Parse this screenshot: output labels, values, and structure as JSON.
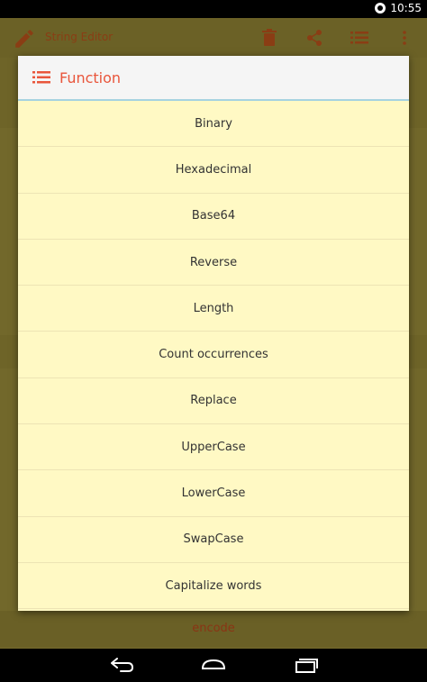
{
  "status": {
    "time": "10:55"
  },
  "appbar": {
    "title": "String Editor",
    "icons": [
      "pencil-icon",
      "delete-icon",
      "share-icon",
      "list-icon",
      "overflow-icon"
    ]
  },
  "background": {
    "action_label": "encode"
  },
  "dialog": {
    "title": "Function",
    "items": [
      "Binary",
      "Hexadecimal",
      "Base64",
      "Reverse",
      "Length",
      "Count occurrences",
      "Replace",
      "UpperCase",
      "LowerCase",
      "SwapCase",
      "Capitalize words"
    ]
  },
  "colors": {
    "accent": "#e9563c",
    "dialog_bg": "#fff9c4",
    "header_bg": "#f5f5f5",
    "divider": "#a6d2e0"
  }
}
